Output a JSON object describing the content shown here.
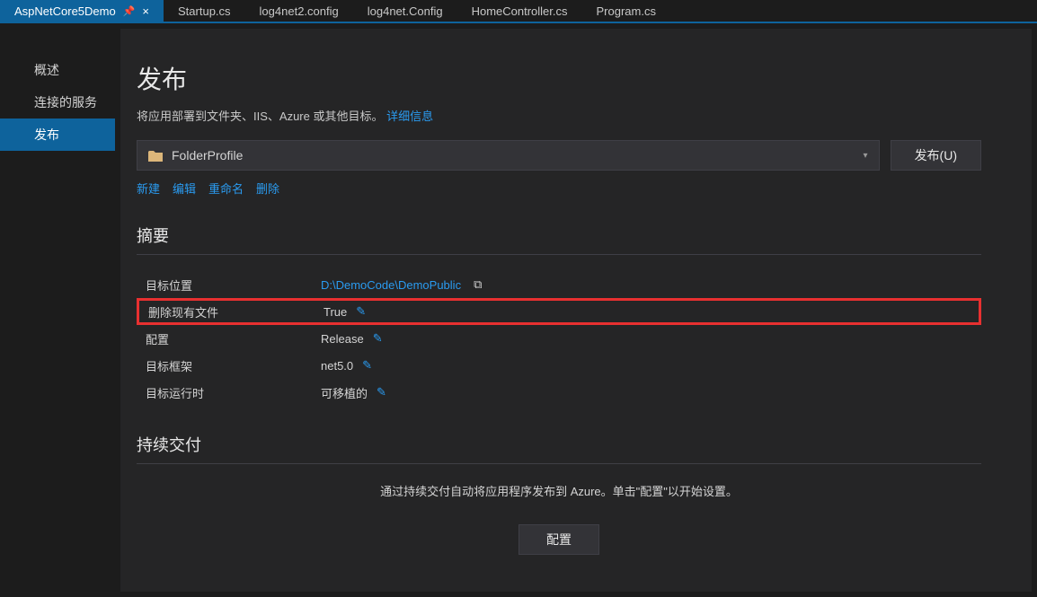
{
  "tabs": [
    {
      "label": "AspNetCore5Demo",
      "active": true,
      "pinned": true
    },
    {
      "label": "Startup.cs",
      "active": false
    },
    {
      "label": "log4net2.config",
      "active": false
    },
    {
      "label": "log4net.Config",
      "active": false
    },
    {
      "label": "HomeController.cs",
      "active": false
    },
    {
      "label": "Program.cs",
      "active": false
    }
  ],
  "sidebar": {
    "items": [
      {
        "label": "概述",
        "active": false
      },
      {
        "label": "连接的服务",
        "active": false
      },
      {
        "label": "发布",
        "active": true
      }
    ]
  },
  "publish": {
    "title": "发布",
    "description": "将应用部署到文件夹、IIS、Azure 或其他目标。",
    "details_link": "详细信息",
    "profile_name": "FolderProfile",
    "publish_button": "发布(U)",
    "actions": {
      "new": "新建",
      "edit": "编辑",
      "rename": "重命名",
      "delete": "删除"
    }
  },
  "summary": {
    "title": "摘要",
    "rows": [
      {
        "label": "目标位置",
        "value": "D:\\DemoCode\\DemoPublic",
        "is_link": true,
        "copyable": true,
        "editable": false
      },
      {
        "label": "删除现有文件",
        "value": "True",
        "is_link": false,
        "copyable": false,
        "editable": true,
        "highlighted": true
      },
      {
        "label": "配置",
        "value": "Release",
        "is_link": false,
        "copyable": false,
        "editable": true
      },
      {
        "label": "目标框架",
        "value": "net5.0",
        "is_link": false,
        "copyable": false,
        "editable": true
      },
      {
        "label": "目标运行时",
        "value": "可移植的",
        "is_link": false,
        "copyable": false,
        "editable": true
      }
    ]
  },
  "cd": {
    "title": "持续交付",
    "description": "通过持续交付自动将应用程序发布到 Azure。单击\"配置\"以开始设置。",
    "config_button": "配置"
  }
}
